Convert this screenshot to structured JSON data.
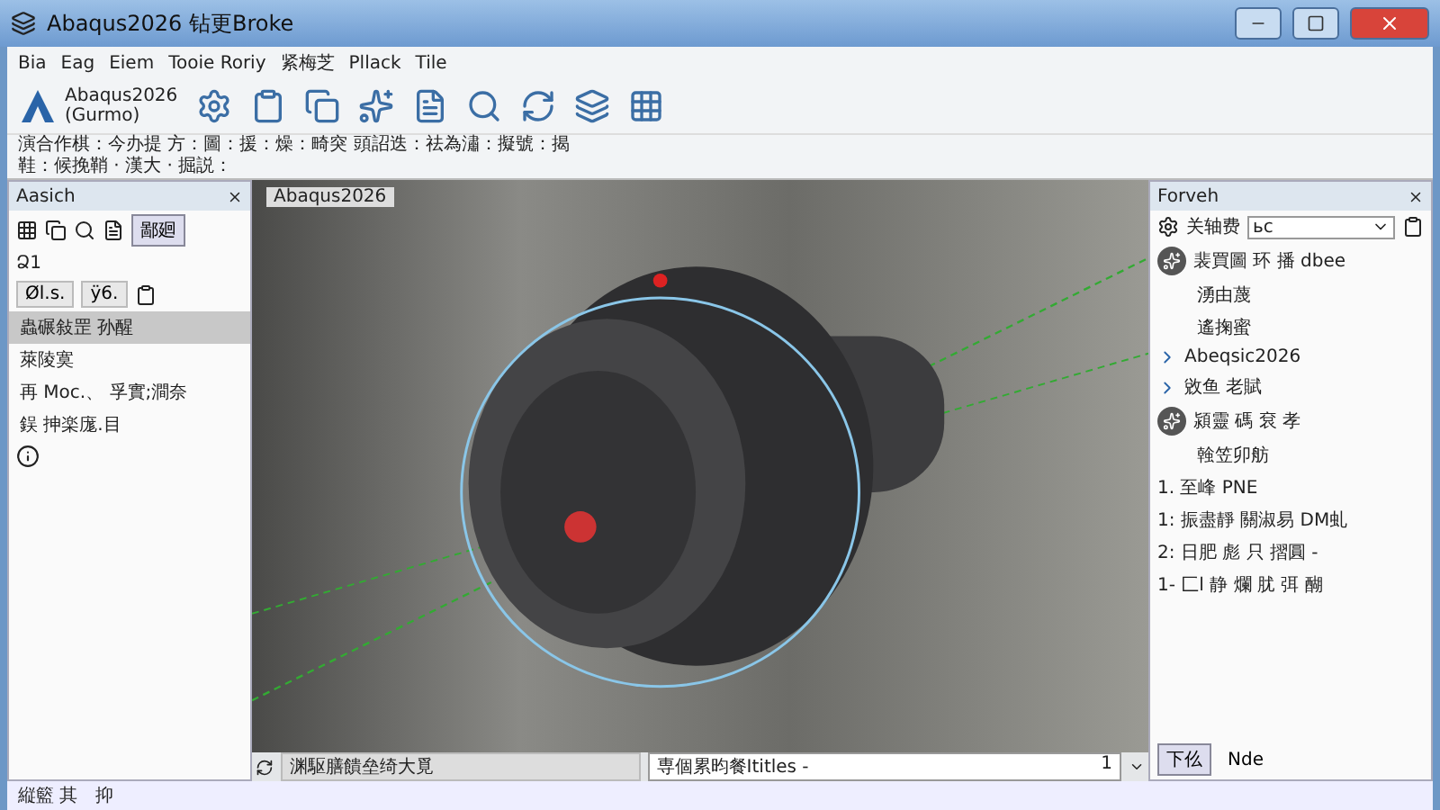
{
  "window": {
    "title": "Abaqus2026 钻更Broke"
  },
  "menu": [
    "Bia",
    "Eag",
    "Eiem",
    "Tooie Roriy",
    "紧梅芝",
    "Pllack",
    "Tile"
  ],
  "toolbar": {
    "brand": "Abaqus2026",
    "brand_sub": "(Gurmo)"
  },
  "ribbon": {
    "line_1": "演合作棋：今办提 方：圖：援：燥：畸突 頭詔迭：祛為潚：擬號：揭",
    "line_2": "鞋：候挽鞘 · 漢大 · 掘説："
  },
  "left_panel": {
    "title": "Aasich",
    "tabs": [
      {
        "label": "鄙廻",
        "selected": true
      }
    ],
    "section": "Ձ1",
    "chips": [
      "Øl.s.",
      "ÿ6."
    ],
    "items": [
      {
        "label": "蟲碾敍罡 孙醒",
        "selected": true
      },
      {
        "label": "萊陵寞",
        "selected": false
      },
      {
        "label": "再 Moc.、 孚實;澗奈",
        "selected": false
      },
      {
        "label": "鋘 抻楽庬.目",
        "selected": false
      }
    ]
  },
  "viewport": {
    "tab": "Abaqus2026",
    "prompt": "渊駆膳饋垒绮大覓",
    "dropdown": "専個累昀餐Ititles -",
    "dropdown_value": "1"
  },
  "right_panel": {
    "title": "Forveh",
    "filter_label": "关轴费",
    "filter_value": "ьс",
    "groups": [
      {
        "title": "裴買圖 环 播 dbee",
        "lines": [
          "湧由蔑",
          "遙掬蜜"
        ],
        "children": [
          "Abeqsic2026",
          "敓鱼 老賦"
        ]
      },
      {
        "title": "潁靈 碼 袞 孝",
        "lines": [
          "螒笠卯舫"
        ]
      }
    ],
    "steps": [
      "1. 至峰 PNE",
      "1: 振盡靜 關淑易 DM虬",
      "2: 日肥 彪 只 摺圓 -",
      "1- 匚l 静 爛 肬 弭 醐"
    ],
    "tabs": [
      {
        "label": "下仫",
        "selected": true
      },
      {
        "label": "Nde",
        "selected": false
      }
    ]
  },
  "status_bar": [
    "縦籃 其",
    "抑"
  ]
}
